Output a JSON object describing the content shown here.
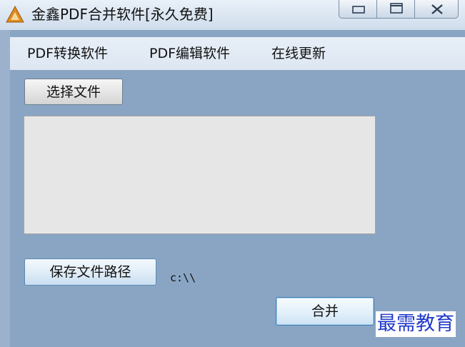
{
  "window": {
    "title": "金鑫PDF合并软件[永久免费]",
    "icon": "triangle-logo-icon",
    "controls": [
      "minimize-icon",
      "maximize-icon",
      "close-icon"
    ]
  },
  "menu": {
    "items": [
      {
        "label": "PDF转换软件"
      },
      {
        "label": "PDF编辑软件"
      },
      {
        "label": "在线更新"
      }
    ]
  },
  "main": {
    "select_file_label": "选择文件",
    "file_list_items": [],
    "save_path_label": "保存文件路径",
    "save_path_value": "c:\\\\",
    "merge_label": "合并"
  },
  "watermark": {
    "text": "最需教育"
  },
  "colors": {
    "window_background": "#8aa5c4",
    "menubar_background": "#e3ebf5",
    "watermark_text": "#1f39c9"
  }
}
